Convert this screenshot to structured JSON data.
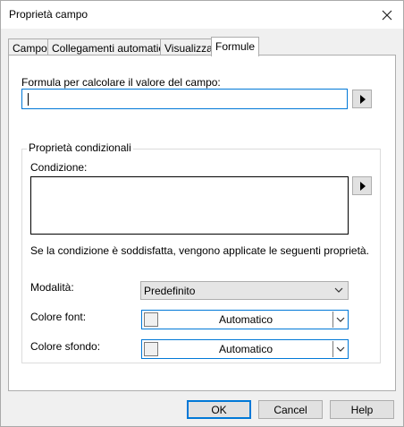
{
  "window": {
    "title": "Proprietà campo"
  },
  "tabs": [
    {
      "label": "Campo"
    },
    {
      "label": "Collegamenti automatici"
    },
    {
      "label": "Visualizza"
    },
    {
      "label": "Formule"
    }
  ],
  "formula": {
    "label": "Formula per calcolare il valore del campo:",
    "value": ""
  },
  "conditional": {
    "group_title": "Proprietà condizionali",
    "condition_label": "Condizione:",
    "condition_value": "",
    "info_text": "Se la condizione è soddisfatta, vengono applicate le seguenti proprietà.",
    "mode_label": "Modalità:",
    "mode_value": "Predefinito",
    "font_color_label": "Colore font:",
    "font_color_value": "Automatico",
    "bg_color_label": "Colore sfondo:",
    "bg_color_value": "Automatico"
  },
  "buttons": {
    "ok": "OK",
    "cancel": "Cancel",
    "help": "Help"
  },
  "icons": {
    "close": "close-icon",
    "arrow": "triangle-right-icon",
    "chevron": "chevron-down-icon"
  },
  "colors": {
    "accent": "#0078d7"
  }
}
